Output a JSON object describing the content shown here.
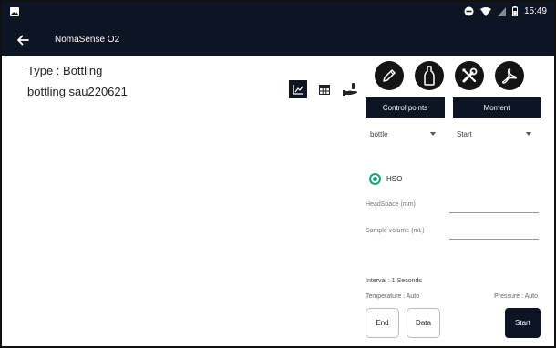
{
  "status_bar": {
    "time": "15:49",
    "icons": [
      "image-icon",
      "do-not-disturb-icon",
      "wifi-icon",
      "signal-icon",
      "battery-icon"
    ]
  },
  "app_bar": {
    "title": "NomaSense O2",
    "back_icon": "arrow-left-icon"
  },
  "measurement": {
    "type_label": "Type : Bottling",
    "name": "bottling sau220621"
  },
  "view_toggles": [
    {
      "icon": "line-chart-icon",
      "active": true
    },
    {
      "icon": "table-grid-icon",
      "active": false
    },
    {
      "icon": "hand-bottle-icon",
      "active": false
    }
  ],
  "action_buttons": [
    {
      "icon": "pencil-icon"
    },
    {
      "icon": "bottle-icon"
    },
    {
      "icon": "tools-icon"
    },
    {
      "icon": "pdf-icon"
    }
  ],
  "tabs": {
    "control_points": "Control points",
    "moment": "Moment"
  },
  "selects": {
    "control_point": "bottle",
    "moment": "Start"
  },
  "radio": {
    "label": "HSO",
    "checked": true
  },
  "fields": {
    "headspace_label": "HeadSpace (mm)",
    "headspace_value": "",
    "sample_volume_label": "Sample volume (mL)",
    "sample_volume_value": ""
  },
  "settings": {
    "interval": "Interval : 1 Seconds",
    "temperature": "Temperature : Auto",
    "pressure": "Pressure : Auto"
  },
  "buttons": {
    "end": "End",
    "data": "Data",
    "start": "Start"
  },
  "colors": {
    "app_bar": "#0d1424",
    "radio_accent": "#1aa37a",
    "action_circle": "#141414"
  }
}
